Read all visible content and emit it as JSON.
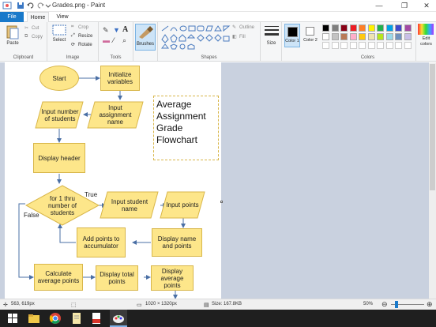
{
  "window": {
    "title": "Grades.png - Paint",
    "minimize": "—",
    "maximize": "❐",
    "close": "✕"
  },
  "tabs": [
    {
      "label": "File"
    },
    {
      "label": "Home"
    },
    {
      "label": "View"
    }
  ],
  "ribbon": {
    "clipboard": {
      "label": "Clipboard",
      "paste": "Paste",
      "cut": "Cut",
      "copy": "Copy"
    },
    "image": {
      "label": "Image",
      "select": "Select",
      "crop": "Crop",
      "resize": "Resize",
      "rotate": "Rotate"
    },
    "tools": {
      "label": "Tools"
    },
    "brushes": {
      "label": "Brushes"
    },
    "shapes": {
      "label": "Shapes",
      "outline": "Outline",
      "fill": "Fill"
    },
    "size": {
      "label": "Size"
    },
    "color1": {
      "label": "Color 1"
    },
    "color2": {
      "label": "Color 2"
    },
    "colors": {
      "label": "Colors"
    },
    "edit_colors": {
      "label": "Edit colors"
    }
  },
  "palette": [
    "#000000",
    "#7f7f7f",
    "#880015",
    "#ed1c24",
    "#ff7f27",
    "#fff200",
    "#22b14c",
    "#00a2e8",
    "#3f48cc",
    "#a349a4",
    "#ffffff",
    "#c3c3c3",
    "#b97a57",
    "#ffaec9",
    "#ffc90e",
    "#efe4b0",
    "#b5e61d",
    "#99d9ea",
    "#7092be",
    "#c8bfe7"
  ],
  "flowchart": {
    "start": "Start",
    "initialize": "Initialize variables",
    "input_students": "Input number of students",
    "input_assignment": "Input assignment name",
    "display_header": "Display header",
    "loop": "for 1 thru number of students",
    "true_label": "True",
    "false_label": "False",
    "input_student_name": "Input student name",
    "input_points": "Input points",
    "add_points": "Add points to accumulator",
    "display_name_points": "Display name and points",
    "calc_average": "Calculate average points",
    "display_total": "Display total points",
    "display_average": "Display average points",
    "title": "Average Assignment Grade Flowchart"
  },
  "status": {
    "cursor": "563, 619px",
    "dimensions": "1020 × 1320px",
    "size": "Size: 167.8KB",
    "zoom": "50%"
  }
}
